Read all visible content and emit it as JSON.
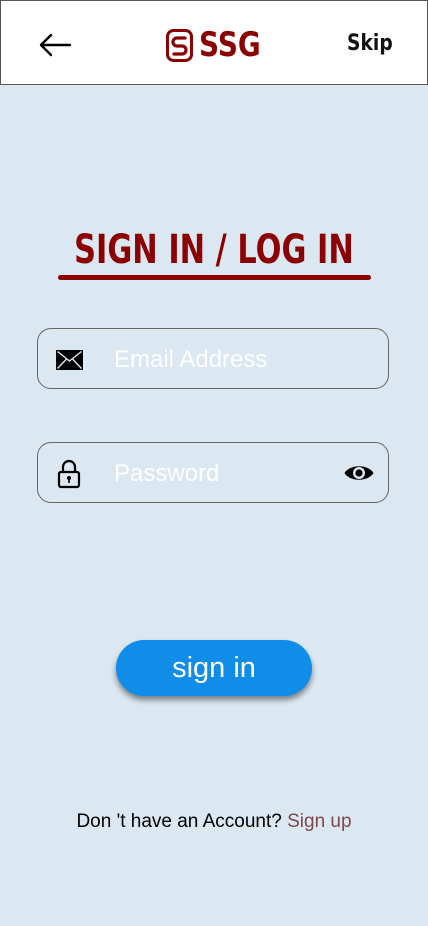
{
  "header": {
    "back_icon": "arrow-left-icon",
    "logo_text": "SSG",
    "skip_label": "Skip",
    "brand_color": "#8b0000"
  },
  "title": "SIGN IN / LOG IN",
  "form": {
    "email": {
      "icon": "envelope-icon",
      "placeholder": "Email Address"
    },
    "password": {
      "icon": "lock-icon",
      "placeholder": "Password",
      "toggle_icon": "eye-icon"
    }
  },
  "sign_in_button": {
    "label": "sign in",
    "color": "#0f8de8"
  },
  "footer": {
    "prompt": "Don 't have an Account?",
    "link": "Sign up"
  },
  "background_color": "#dbe7f1"
}
